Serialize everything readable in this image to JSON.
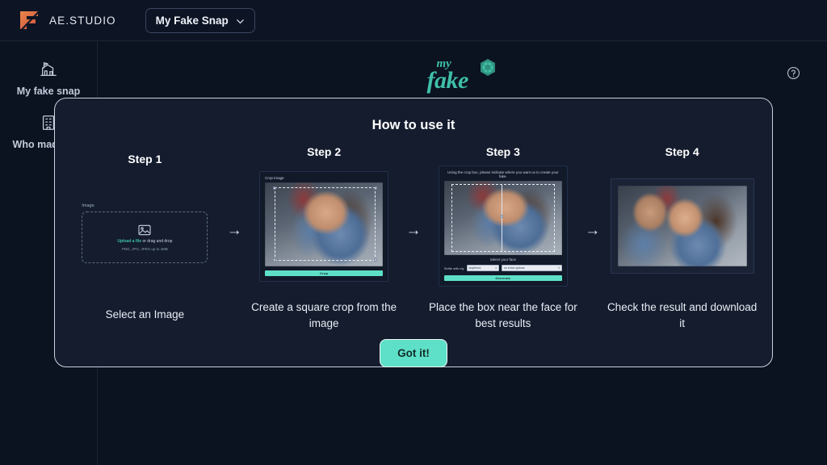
{
  "topbar": {
    "brand_name": "AE.STUDIO",
    "logo_icon": "ae-studio-logo-icon",
    "project_label": "My Fake Snap",
    "chevron_icon": "chevron-down-icon"
  },
  "sidebar": {
    "items": [
      {
        "label": "My fake snap",
        "icon": "house-flag-icon"
      },
      {
        "label": "Who made this",
        "icon": "office-building-icon"
      }
    ]
  },
  "main": {
    "logo_top": "my",
    "logo_bottom": "fake",
    "logo_icon": "camera-shutter-icon",
    "help_icon": "question-mark-circle-icon"
  },
  "modal": {
    "title": "How to use it",
    "cta_label": "Got it!",
    "arrow_glyph": "→",
    "steps": [
      {
        "heading": "Step 1",
        "caption": "Select an Image",
        "uploader": {
          "field_label": "Image",
          "picture_icon": "picture-placeholder-icon",
          "action_text": "Upload a file",
          "drag_text": " or drag and drop",
          "hint_text": "PNG, JPG, JPEG up to 4MB"
        }
      },
      {
        "heading": "Step 2",
        "caption": "Create a square crop from the image",
        "panel": {
          "label": "Crop Image",
          "button_label": "Crop"
        }
      },
      {
        "heading": "Step 3",
        "caption": "Place the box near the face for best results",
        "panel": {
          "label": "Using the crop box, please indicate where you want us to create your fake.",
          "select_face_label": "Select your face",
          "form_label": "Selfie with my",
          "select_1_value": "boyfriend",
          "select_2_value": "no extra options",
          "button_label": "Generate"
        }
      },
      {
        "heading": "Step 4",
        "caption": "Check the result and download it",
        "panel": {
          "label": ""
        }
      }
    ]
  },
  "colors": {
    "accent_teal": "#5ee0c8",
    "brand_orange": "#e0713e",
    "logo_green": "#3fbfa8",
    "page_bg": "#0b1220",
    "modal_bg": "#141c2e"
  }
}
